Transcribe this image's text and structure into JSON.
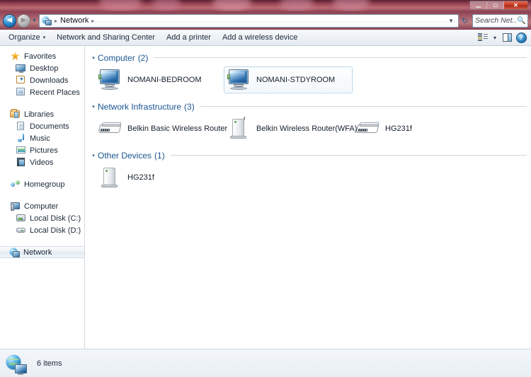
{
  "window": {
    "title": "Network",
    "controls": {
      "minimize": "–",
      "restore": "❐",
      "close": "✕"
    }
  },
  "nav": {
    "back_label": "◀",
    "forward_label": "▶",
    "history_caret": "▼",
    "address_icon": "network-icon",
    "breadcrumbs": [
      "Network"
    ],
    "separator": "▸",
    "dropdown_caret": "▼",
    "refresh_label": "↻"
  },
  "search": {
    "placeholder": "Search Net...",
    "value": "",
    "icon": "magnifier-icon"
  },
  "toolbar": {
    "organize": "Organize",
    "organize_caret": "▾",
    "network_sharing_center": "Network and Sharing Center",
    "add_printer": "Add a printer",
    "add_wireless_device": "Add a wireless device",
    "view_caret": "▾",
    "help_label": "?"
  },
  "sidebar": {
    "groups": [
      {
        "header": {
          "label": "Favorites",
          "icon": "star-icon"
        },
        "items": [
          {
            "label": "Desktop",
            "icon": "desktop-icon"
          },
          {
            "label": "Downloads",
            "icon": "downloads-icon"
          },
          {
            "label": "Recent Places",
            "icon": "recent-places-icon"
          }
        ]
      },
      {
        "header": {
          "label": "Libraries",
          "icon": "libraries-icon"
        },
        "items": [
          {
            "label": "Documents",
            "icon": "documents-icon"
          },
          {
            "label": "Music",
            "icon": "music-icon"
          },
          {
            "label": "Pictures",
            "icon": "pictures-icon"
          },
          {
            "label": "Videos",
            "icon": "videos-icon"
          }
        ]
      },
      {
        "header": {
          "label": "Homegroup",
          "icon": "homegroup-icon"
        },
        "items": []
      },
      {
        "header": {
          "label": "Computer",
          "icon": "computer-icon"
        },
        "items": [
          {
            "label": "Local Disk (C:)",
            "icon": "hard-disk-icon"
          },
          {
            "label": "Local Disk (D:)",
            "icon": "optical-disk-icon"
          }
        ]
      },
      {
        "header": {
          "label": "Network",
          "icon": "network-icon",
          "selected": true
        },
        "items": []
      }
    ]
  },
  "content": {
    "groups": [
      {
        "title": "Computer",
        "count": "(2)",
        "collapse_caret": "▾",
        "items": [
          {
            "label": "NOMANI-BEDROOM",
            "icon": "computer-monitor-icon",
            "selected": false
          },
          {
            "label": "NOMANI-STDYROOM",
            "icon": "computer-monitor-icon",
            "selected": true
          }
        ]
      },
      {
        "title": "Network Infrastructure",
        "count": "(3)",
        "collapse_caret": "▾",
        "items": [
          {
            "label": "Belkin Basic Wireless Router",
            "icon": "router-icon",
            "selected": false
          },
          {
            "label": "Belkin Wireless Router(WFA)",
            "icon": "tower-device-icon",
            "selected": false
          },
          {
            "label": "HG231f",
            "icon": "router-icon",
            "selected": false
          }
        ]
      },
      {
        "title": "Other Devices",
        "count": "(1)",
        "collapse_caret": "▾",
        "items": [
          {
            "label": "HG231f",
            "icon": "tower-device-icon",
            "selected": false
          }
        ]
      }
    ]
  },
  "statusbar": {
    "icon": "network-globe-icon",
    "text": "6 items"
  }
}
